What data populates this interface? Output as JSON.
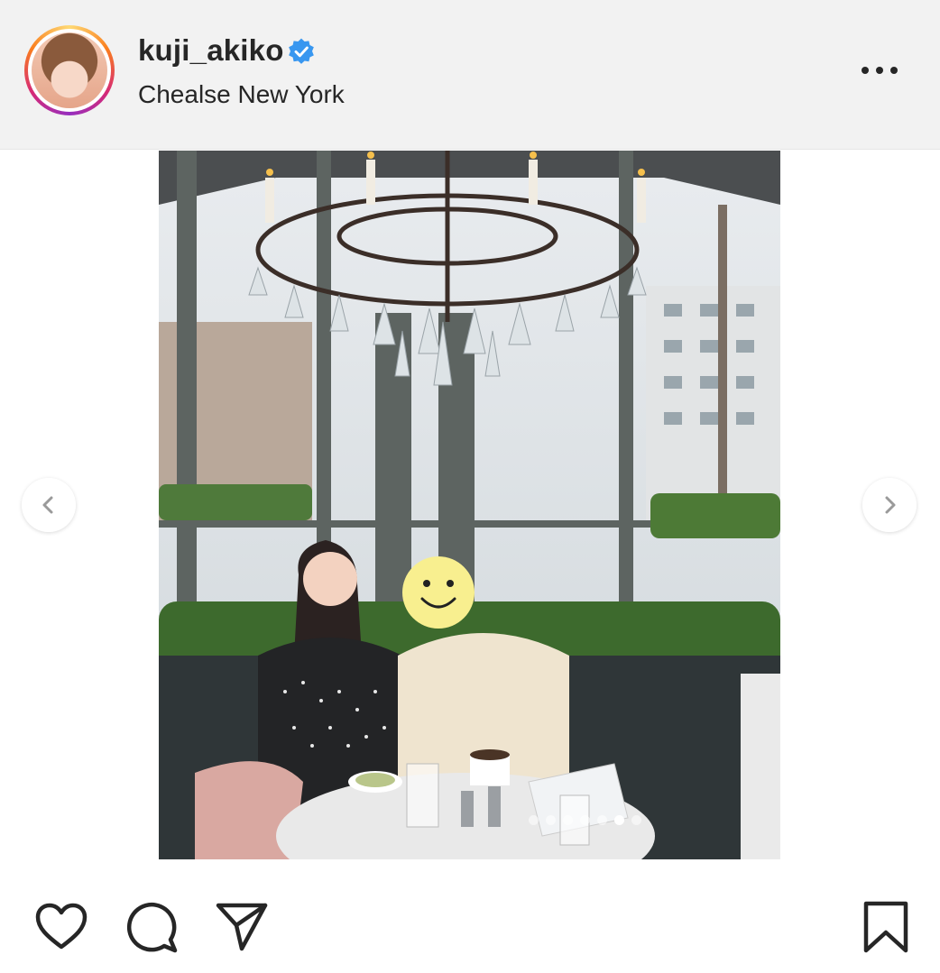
{
  "post": {
    "username": "kuji_akiko",
    "location": "Chealse New York",
    "verified": true,
    "carousel": {
      "total": 7,
      "current": 6
    }
  },
  "icons": {
    "verified": "verified-badge-icon",
    "more": "more-options-icon",
    "prev": "chevron-left-icon",
    "next": "chevron-right-icon",
    "like": "heart-icon",
    "comment": "comment-icon",
    "share": "paper-plane-icon",
    "save": "bookmark-icon"
  },
  "colors": {
    "verified_blue": "#3897f0",
    "icon_dark": "#262626",
    "header_bg": "#f2f2f2"
  }
}
